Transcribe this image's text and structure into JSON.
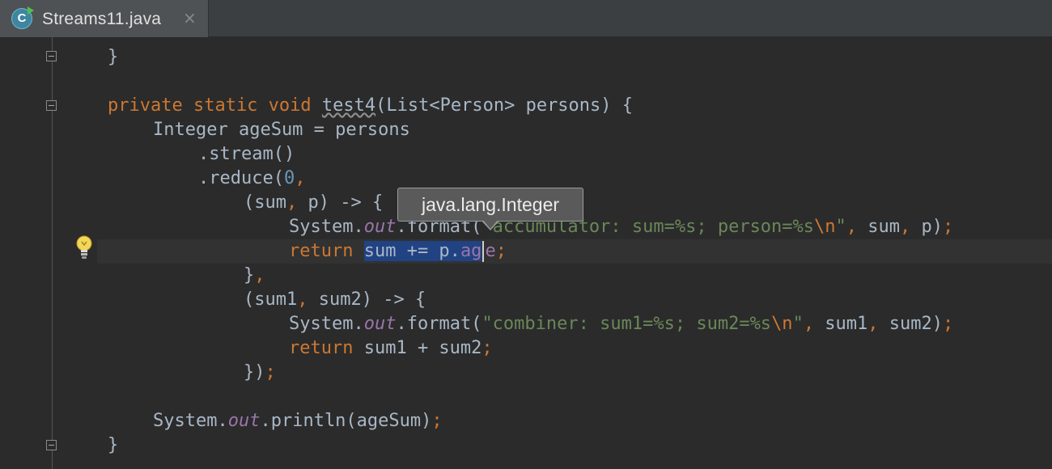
{
  "tab": {
    "icon_letter": "C",
    "label": "Streams11.java",
    "close_label": "×"
  },
  "tooltip": {
    "text": "java.lang.Integer"
  },
  "code": {
    "l1": {
      "brace": "}"
    },
    "l2": {
      "kw": "private static void ",
      "method": "test4",
      "rest": "(List<Person> persons) {"
    },
    "l3": {
      "text": "Integer ageSum = persons"
    },
    "l4": {
      "text": ".stream()"
    },
    "l5": {
      "pre": ".reduce(",
      "num": "0",
      "post": ","
    },
    "l6": {
      "pre": "(sum",
      "comma": ",",
      "post": " p) -> {"
    },
    "l7": {
      "sys": "System.",
      "out": "out",
      "fmt": ".format(",
      "str": "\"accumulator: sum=%s; person=%s",
      "esc": "\\n",
      "strend": "\"",
      "c1": ",",
      "a1": " sum",
      "c2": ",",
      "a2": " p)",
      "semi": ";"
    },
    "l8": {
      "kw": "return ",
      "sel_pre": "sum += p.",
      "sel_fld": "ag",
      "fld_rest": "e",
      "semi": ";"
    },
    "l9": {
      "brace": "}",
      "comma": ","
    },
    "l10": {
      "pre": "(sum1",
      "comma": ",",
      "post": " sum2) -> {"
    },
    "l11": {
      "sys": "System.",
      "out": "out",
      "fmt": ".format(",
      "str": "\"combiner: sum1=%s; sum2=%s",
      "esc": "\\n",
      "strend": "\"",
      "c1": ",",
      "a1": " sum1",
      "c2": ",",
      "a2": " sum2)",
      "semi": ";"
    },
    "l12": {
      "kw": "return ",
      "text": "sum1 + sum2",
      "semi": ";"
    },
    "l13": {
      "text": "})",
      "semi": ";"
    },
    "l14": {
      "sys": "System.",
      "out": "out",
      "rest": ".println(ageSum)",
      "semi": ";"
    },
    "l15": {
      "brace": "}"
    }
  }
}
